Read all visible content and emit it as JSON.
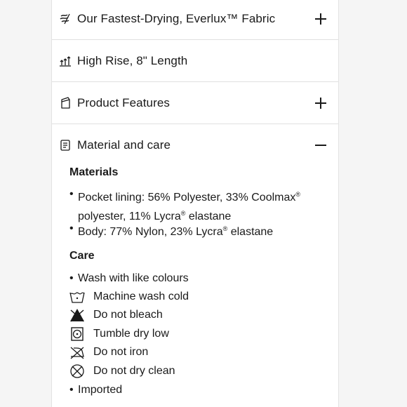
{
  "accordion": {
    "items": [
      {
        "label": "Our Fastest-Drying, Everlux™ Fabric",
        "icon": "fabric-icon",
        "state": "collapsed"
      },
      {
        "label": "High Rise, 8\" Length",
        "icon": "rise-length-icon",
        "state": "none"
      },
      {
        "label": "Product Features",
        "icon": "features-icon",
        "state": "collapsed"
      },
      {
        "label": "Material and care",
        "icon": "care-tag-icon",
        "state": "expanded"
      }
    ]
  },
  "materials": {
    "heading": "Materials",
    "pocket_line1": "Pocket lining: 56% Polyester, 33% Coolmax",
    "pocket_line2a": "polyester, 11% Lycra",
    "pocket_line2b": " elastane",
    "body_a": "Body: 77% Nylon, 23% Lycra",
    "body_b": " elastane",
    "registered": "®",
    "bullet": "•"
  },
  "care": {
    "heading": "Care",
    "wash_colours": "Wash with like colours",
    "items": [
      {
        "label": "Machine wash cold",
        "icon": "machine-wash-cold-icon"
      },
      {
        "label": "Do not bleach",
        "icon": "do-not-bleach-icon"
      },
      {
        "label": "Tumble dry low",
        "icon": "tumble-dry-low-icon"
      },
      {
        "label": "Do not iron",
        "icon": "do-not-iron-icon"
      },
      {
        "label": "Do not dry clean",
        "icon": "do-not-dry-clean-icon"
      }
    ],
    "imported": "Imported"
  }
}
